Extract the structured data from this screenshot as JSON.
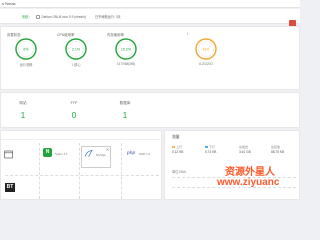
{
  "topbar": {
    "brand": "s Nmas"
  },
  "infobar": {
    "status_label": "系统：",
    "os": "Debian GNU/Linux 9.9 (stretch)",
    "uptime": "已不间断运行: 3天"
  },
  "status_gauges": [
    {
      "label": "负载状态",
      "value": "6%",
      "sub": "运行流畅",
      "color": "#20a53a"
    },
    {
      "label": "CPU使用率",
      "value": "2.1%",
      "sub": "1 核心",
      "color": "#20a53a"
    },
    {
      "label": "内存使用率",
      "value": "15.2%",
      "sub": "147/968(MB)",
      "color": "#20a53a"
    },
    {
      "label": "/",
      "value": "43%",
      "sub": "8.2G/20G",
      "color": "#f0a732"
    }
  ],
  "counts": [
    {
      "label": "网站",
      "value": "1"
    },
    {
      "label": "FTP",
      "value": "0"
    },
    {
      "label": "数据库",
      "value": "1"
    }
  ],
  "software": [
    {
      "name": "Nginx 1.1",
      "icon": "nginx-icon",
      "color": "#20a53a"
    },
    {
      "name": "MySQL",
      "icon": "mysql-icon",
      "color": "#2b6fb3"
    },
    {
      "name": "PHP-7.2",
      "icon": "php-icon",
      "color": "#6c7eb7"
    }
  ],
  "traffic": {
    "title": "流量",
    "stats": [
      {
        "label": "上行",
        "value": "0.12 KB",
        "color": "#f7b851"
      },
      {
        "label": "下行",
        "value": "0.74 KB",
        "color": "#52a9ff"
      },
      {
        "label": "总发送",
        "value": "3.61 GB",
        "color": ""
      },
      {
        "label": "总接收",
        "value": "88.75 KB",
        "color": ""
      }
    ],
    "unit_label": "单位:KB/s"
  },
  "watermark": {
    "line1": "资源外星人",
    "line2": "www.ziyuanc"
  }
}
